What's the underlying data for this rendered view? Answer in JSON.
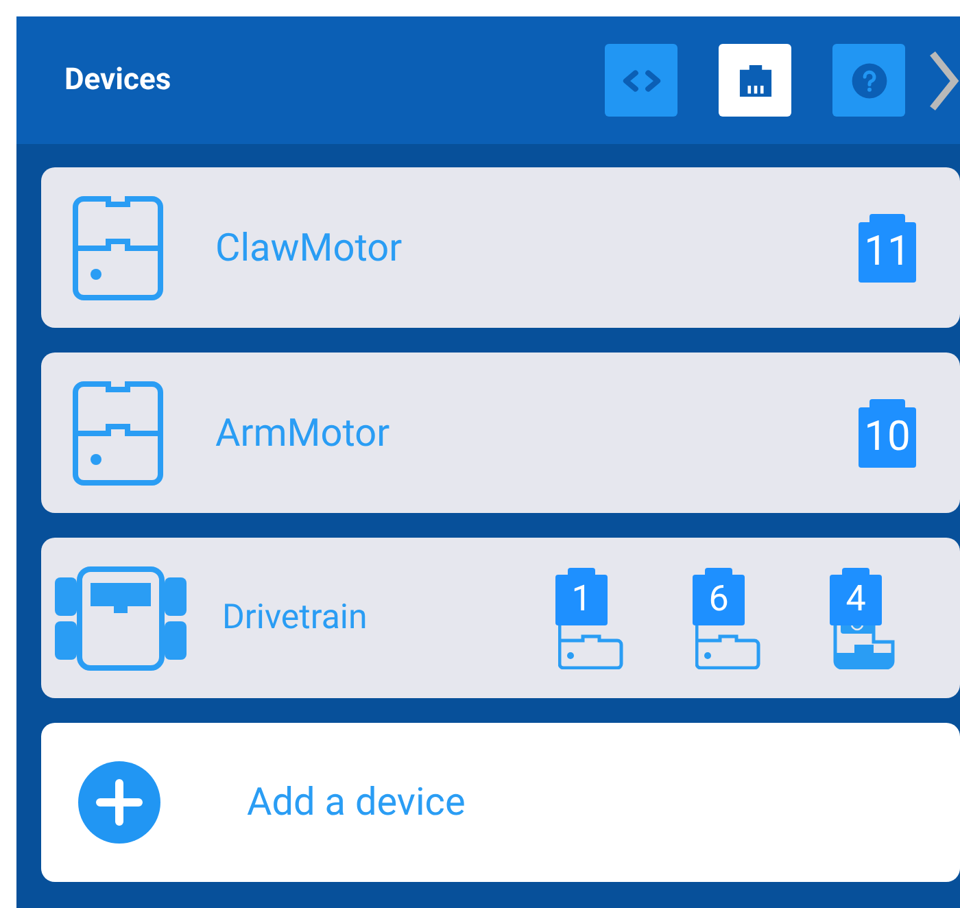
{
  "header": {
    "title": "Devices",
    "tools": [
      {
        "kind": "code",
        "selected": false
      },
      {
        "kind": "ports",
        "selected": true
      },
      {
        "kind": "help",
        "selected": false
      }
    ]
  },
  "devices": [
    {
      "kind": "motor",
      "name": "ClawMotor",
      "ports": [
        {
          "kind": "port",
          "label": "11"
        }
      ]
    },
    {
      "kind": "motor",
      "name": "ArmMotor",
      "ports": [
        {
          "kind": "port",
          "label": "10"
        }
      ]
    },
    {
      "kind": "drivetrain",
      "name": "Drivetrain",
      "ports": [
        {
          "kind": "motor",
          "label": "1"
        },
        {
          "kind": "motor",
          "label": "6"
        },
        {
          "kind": "sensor",
          "label": "4"
        }
      ]
    }
  ],
  "add_button": {
    "label": "Add a device"
  }
}
